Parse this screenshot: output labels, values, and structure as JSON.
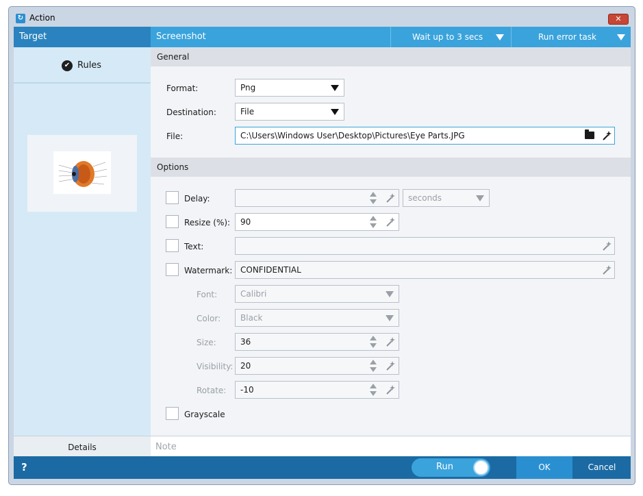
{
  "window": {
    "title": "Action",
    "close_glyph": "✕"
  },
  "header": {
    "target": "Target",
    "title": "Screenshot",
    "wait": "Wait up to 3 secs",
    "error_task": "Run error task"
  },
  "sidebar": {
    "rules": "Rules",
    "details": "Details"
  },
  "general": {
    "section": "General",
    "format_label": "Format:",
    "format_value": "Png",
    "destination_label": "Destination:",
    "destination_value": "File",
    "file_label": "File:",
    "file_value": "C:\\Users\\Windows User\\Desktop\\Pictures\\Eye Parts.JPG"
  },
  "options": {
    "section": "Options",
    "delay_label": "Delay:",
    "delay_value": "",
    "delay_unit": "seconds",
    "resize_label": "Resize (%):",
    "resize_value": "90",
    "text_label": "Text:",
    "text_value": "",
    "watermark_label": "Watermark:",
    "watermark_value": "CONFIDENTIAL",
    "font_label": "Font:",
    "font_value": "Calibri",
    "color_label": "Color:",
    "color_value": "Black",
    "size_label": "Size:",
    "size_value": "36",
    "visibility_label": "Visibility:",
    "visibility_value": "20",
    "rotate_label": "Rotate:",
    "rotate_value": "-10",
    "grayscale_label": "Grayscale"
  },
  "note": {
    "placeholder": "Note"
  },
  "footer": {
    "help": "?",
    "run": "Run",
    "ok": "OK",
    "cancel": "Cancel"
  },
  "colors": {
    "accent": "#3aa3dc",
    "header_dark": "#2a83be",
    "footer": "#1b6aa3"
  }
}
